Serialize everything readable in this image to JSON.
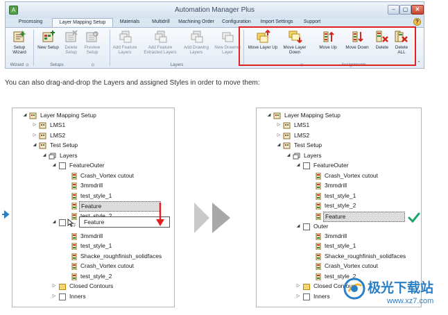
{
  "window": {
    "title": "Automation Manager Plus",
    "app_icon": "A",
    "controls": {
      "minimize": "–",
      "maximize": "▢",
      "close": "✕"
    }
  },
  "tabs": [
    {
      "label": "Processing"
    },
    {
      "label": "Layer Mapping Setup",
      "active": true
    },
    {
      "label": "Materials"
    },
    {
      "label": "Multidrill"
    },
    {
      "label": "Machining Order"
    },
    {
      "label": "Configuration"
    },
    {
      "label": "Import Settings"
    },
    {
      "label": "Support"
    }
  ],
  "help_icon": "?",
  "ribbon": {
    "buttons": [
      {
        "label": "Setup\nWizard",
        "icon": "wizard-icon"
      },
      {
        "label": "New Setup",
        "icon": "new-setup-icon"
      },
      {
        "label": "Delete\nSetup",
        "icon": "delete-setup-icon",
        "disabled": true
      },
      {
        "label": "Preview\nSetup",
        "icon": "preview-setup-icon",
        "disabled": true
      },
      {
        "label": "Add Feature\nLayers",
        "icon": "add-feature-layers-icon",
        "disabled": true
      },
      {
        "label": "Add Feature\nExtracted Layers",
        "icon": "add-feature-extracted-icon",
        "disabled": true
      },
      {
        "label": "Add Drawing\nLayers",
        "icon": "add-drawing-layers-icon",
        "disabled": true
      },
      {
        "label": "New Drawing\nLayer",
        "icon": "new-drawing-layer-icon",
        "disabled": true
      },
      {
        "label": "Move Layer Up",
        "icon": "move-layer-up-icon"
      },
      {
        "label": "Move Layer\nDown",
        "icon": "move-layer-down-icon"
      },
      {
        "label": "Move Up",
        "icon": "move-up-icon"
      },
      {
        "label": "Move Down",
        "icon": "move-down-icon"
      },
      {
        "label": "Delete",
        "icon": "delete-icon"
      },
      {
        "label": "Delete\nALL",
        "icon": "delete-all-icon"
      }
    ],
    "groups": {
      "wizard": "Wizard",
      "setups": "Setups",
      "layers": "Layers",
      "assignments": "Assignments"
    },
    "collapse": "⌃"
  },
  "caption": "You can also drag-and-drop the Layers and assigned Styles in order to move them:",
  "tree_before": [
    {
      "label": "Layer Mapping Setup"
    },
    {
      "label": "LMS1"
    },
    {
      "label": "LMS2"
    },
    {
      "label": "Test Setup"
    },
    {
      "label": "Layers"
    },
    {
      "label": "FeatureOuter"
    },
    {
      "label": "Crash_Vortex cutout"
    },
    {
      "label": "3mmdrill"
    },
    {
      "label": "test_style_1"
    },
    {
      "label": "Feature"
    },
    {
      "label": "test_style_2"
    },
    {
      "label": "Feature"
    },
    {
      "label": "3mmdrill"
    },
    {
      "label": "test_style_1"
    },
    {
      "label": "Shacke_roughfinish_solidfaces"
    },
    {
      "label": "Crash_Vortex cutout"
    },
    {
      "label": "test_style_2"
    },
    {
      "label": "Closed Contours"
    },
    {
      "label": "Inners"
    }
  ],
  "tree_after": [
    {
      "label": "Layer Mapping Setup"
    },
    {
      "label": "LMS1"
    },
    {
      "label": "LMS2"
    },
    {
      "label": "Test Setup"
    },
    {
      "label": "Layers"
    },
    {
      "label": "FeatureOuter"
    },
    {
      "label": "Crash_Vortex cutout"
    },
    {
      "label": "3mmdrill"
    },
    {
      "label": "test_style_1"
    },
    {
      "label": "test_style_2"
    },
    {
      "label": "Feature"
    },
    {
      "label": "Outer"
    },
    {
      "label": "3mmdrill"
    },
    {
      "label": "test_style_1"
    },
    {
      "label": "Shacke_roughfinish_solidfaces"
    },
    {
      "label": "Crash_Vortex cutout"
    },
    {
      "label": "test_style_2"
    },
    {
      "label": "Closed Contours"
    },
    {
      "label": "Inners"
    }
  ],
  "watermark": {
    "title": "极光下载站",
    "url": "www.xz7.com"
  },
  "colors": {
    "highlight": "#e0211f",
    "drag_arrow": "#e0211f",
    "check": "#1fa36b",
    "watermark": "#2a7fc5"
  }
}
